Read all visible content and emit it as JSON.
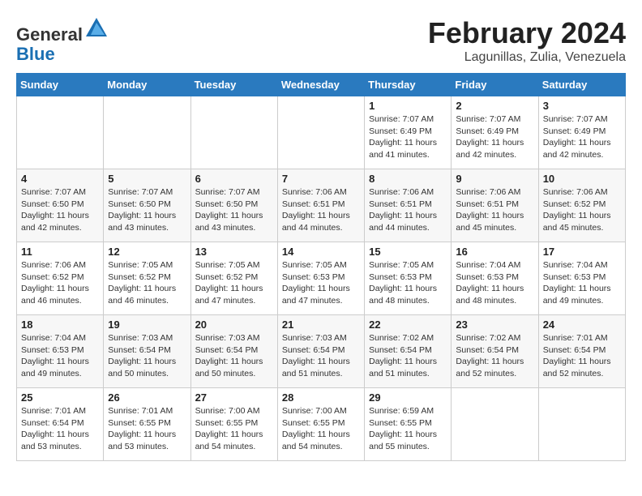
{
  "header": {
    "logo_general": "General",
    "logo_blue": "Blue",
    "month_year": "February 2024",
    "location": "Lagunillas, Zulia, Venezuela"
  },
  "weekdays": [
    "Sunday",
    "Monday",
    "Tuesday",
    "Wednesday",
    "Thursday",
    "Friday",
    "Saturday"
  ],
  "weeks": [
    [
      {
        "day": "",
        "info": ""
      },
      {
        "day": "",
        "info": ""
      },
      {
        "day": "",
        "info": ""
      },
      {
        "day": "",
        "info": ""
      },
      {
        "day": "1",
        "info": "Sunrise: 7:07 AM\nSunset: 6:49 PM\nDaylight: 11 hours and 41 minutes."
      },
      {
        "day": "2",
        "info": "Sunrise: 7:07 AM\nSunset: 6:49 PM\nDaylight: 11 hours and 42 minutes."
      },
      {
        "day": "3",
        "info": "Sunrise: 7:07 AM\nSunset: 6:49 PM\nDaylight: 11 hours and 42 minutes."
      }
    ],
    [
      {
        "day": "4",
        "info": "Sunrise: 7:07 AM\nSunset: 6:50 PM\nDaylight: 11 hours and 42 minutes."
      },
      {
        "day": "5",
        "info": "Sunrise: 7:07 AM\nSunset: 6:50 PM\nDaylight: 11 hours and 43 minutes."
      },
      {
        "day": "6",
        "info": "Sunrise: 7:07 AM\nSunset: 6:50 PM\nDaylight: 11 hours and 43 minutes."
      },
      {
        "day": "7",
        "info": "Sunrise: 7:06 AM\nSunset: 6:51 PM\nDaylight: 11 hours and 44 minutes."
      },
      {
        "day": "8",
        "info": "Sunrise: 7:06 AM\nSunset: 6:51 PM\nDaylight: 11 hours and 44 minutes."
      },
      {
        "day": "9",
        "info": "Sunrise: 7:06 AM\nSunset: 6:51 PM\nDaylight: 11 hours and 45 minutes."
      },
      {
        "day": "10",
        "info": "Sunrise: 7:06 AM\nSunset: 6:52 PM\nDaylight: 11 hours and 45 minutes."
      }
    ],
    [
      {
        "day": "11",
        "info": "Sunrise: 7:06 AM\nSunset: 6:52 PM\nDaylight: 11 hours and 46 minutes."
      },
      {
        "day": "12",
        "info": "Sunrise: 7:05 AM\nSunset: 6:52 PM\nDaylight: 11 hours and 46 minutes."
      },
      {
        "day": "13",
        "info": "Sunrise: 7:05 AM\nSunset: 6:52 PM\nDaylight: 11 hours and 47 minutes."
      },
      {
        "day": "14",
        "info": "Sunrise: 7:05 AM\nSunset: 6:53 PM\nDaylight: 11 hours and 47 minutes."
      },
      {
        "day": "15",
        "info": "Sunrise: 7:05 AM\nSunset: 6:53 PM\nDaylight: 11 hours and 48 minutes."
      },
      {
        "day": "16",
        "info": "Sunrise: 7:04 AM\nSunset: 6:53 PM\nDaylight: 11 hours and 48 minutes."
      },
      {
        "day": "17",
        "info": "Sunrise: 7:04 AM\nSunset: 6:53 PM\nDaylight: 11 hours and 49 minutes."
      }
    ],
    [
      {
        "day": "18",
        "info": "Sunrise: 7:04 AM\nSunset: 6:53 PM\nDaylight: 11 hours and 49 minutes."
      },
      {
        "day": "19",
        "info": "Sunrise: 7:03 AM\nSunset: 6:54 PM\nDaylight: 11 hours and 50 minutes."
      },
      {
        "day": "20",
        "info": "Sunrise: 7:03 AM\nSunset: 6:54 PM\nDaylight: 11 hours and 50 minutes."
      },
      {
        "day": "21",
        "info": "Sunrise: 7:03 AM\nSunset: 6:54 PM\nDaylight: 11 hours and 51 minutes."
      },
      {
        "day": "22",
        "info": "Sunrise: 7:02 AM\nSunset: 6:54 PM\nDaylight: 11 hours and 51 minutes."
      },
      {
        "day": "23",
        "info": "Sunrise: 7:02 AM\nSunset: 6:54 PM\nDaylight: 11 hours and 52 minutes."
      },
      {
        "day": "24",
        "info": "Sunrise: 7:01 AM\nSunset: 6:54 PM\nDaylight: 11 hours and 52 minutes."
      }
    ],
    [
      {
        "day": "25",
        "info": "Sunrise: 7:01 AM\nSunset: 6:54 PM\nDaylight: 11 hours and 53 minutes."
      },
      {
        "day": "26",
        "info": "Sunrise: 7:01 AM\nSunset: 6:55 PM\nDaylight: 11 hours and 53 minutes."
      },
      {
        "day": "27",
        "info": "Sunrise: 7:00 AM\nSunset: 6:55 PM\nDaylight: 11 hours and 54 minutes."
      },
      {
        "day": "28",
        "info": "Sunrise: 7:00 AM\nSunset: 6:55 PM\nDaylight: 11 hours and 54 minutes."
      },
      {
        "day": "29",
        "info": "Sunrise: 6:59 AM\nSunset: 6:55 PM\nDaylight: 11 hours and 55 minutes."
      },
      {
        "day": "",
        "info": ""
      },
      {
        "day": "",
        "info": ""
      }
    ]
  ]
}
